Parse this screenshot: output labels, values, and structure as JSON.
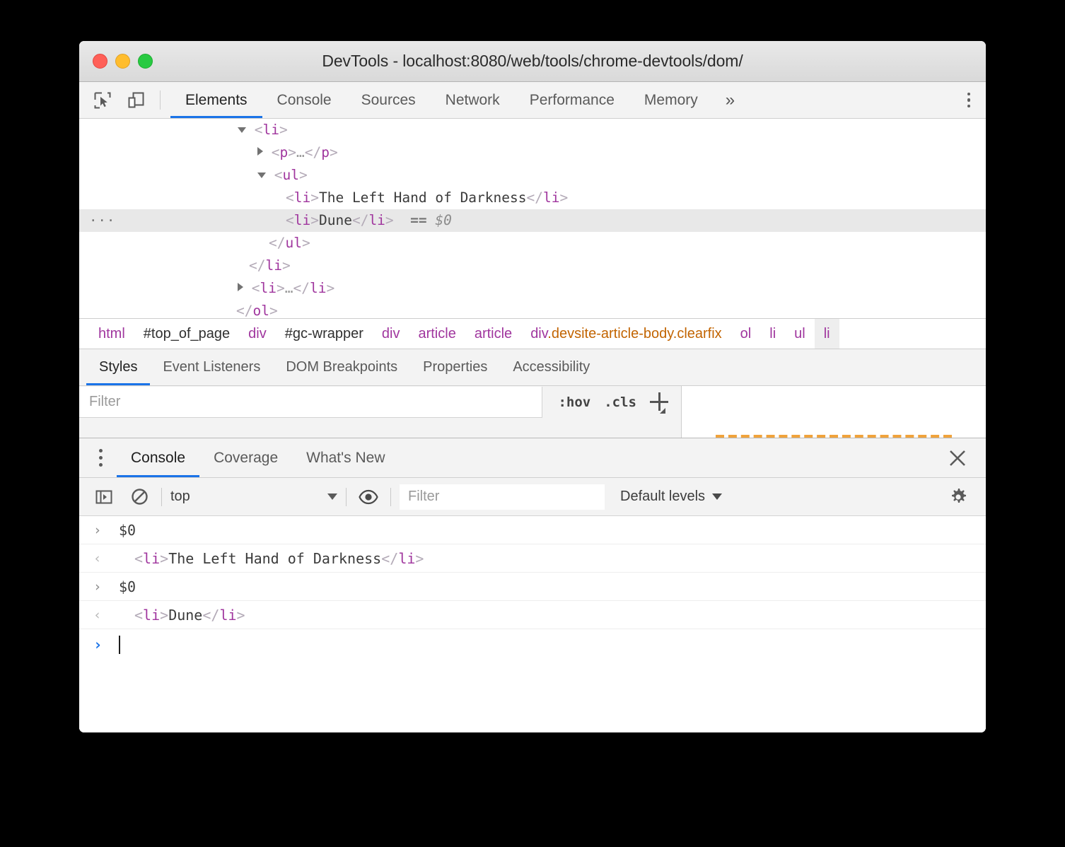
{
  "window": {
    "title": "DevTools - localhost:8080/web/tools/chrome-devtools/dom/",
    "traffic_lights": {
      "close": "close-button",
      "minimize": "minimize-button",
      "maximize": "maximize-button"
    },
    "colors": {
      "close": "#ff6058",
      "minimize": "#ffbd2e",
      "maximize": "#28ca42",
      "accent": "#1a73e8",
      "tag": "#a0369e",
      "class": "#c26401",
      "selected_row": "#e8e8e8",
      "box_model_margin": "#f0a33c"
    }
  },
  "toolbar": {
    "inspect_icon": "inspect-element-icon",
    "device_icon": "device-toolbar-icon",
    "more_tabs_label": "»",
    "main_menu_icon": "main-menu-icon",
    "tabs": [
      {
        "label": "Elements",
        "active": true
      },
      {
        "label": "Console",
        "active": false
      },
      {
        "label": "Sources",
        "active": false
      },
      {
        "label": "Network",
        "active": false
      },
      {
        "label": "Performance",
        "active": false
      },
      {
        "label": "Memory",
        "active": false
      }
    ]
  },
  "elements": {
    "dom_rows": [
      {
        "indent": 224,
        "twisty": "open",
        "selected": false,
        "parts": [
          {
            "c": "br",
            "t": "<"
          },
          {
            "c": "tag",
            "t": "li"
          },
          {
            "c": "br",
            "t": ">"
          }
        ]
      },
      {
        "indent": 252,
        "twisty": "closed",
        "selected": false,
        "parts": [
          {
            "c": "br",
            "t": "<"
          },
          {
            "c": "tag",
            "t": "p"
          },
          {
            "c": "br",
            "t": ">"
          },
          {
            "c": "ell",
            "t": "…"
          },
          {
            "c": "br",
            "t": "</"
          },
          {
            "c": "tag",
            "t": "p"
          },
          {
            "c": "br",
            "t": ">"
          }
        ]
      },
      {
        "indent": 252,
        "twisty": "open",
        "selected": false,
        "parts": [
          {
            "c": "br",
            "t": "<"
          },
          {
            "c": "tag",
            "t": "ul"
          },
          {
            "c": "br",
            "t": ">"
          }
        ]
      },
      {
        "indent": 292,
        "twisty": "none",
        "selected": false,
        "parts": [
          {
            "c": "br",
            "t": "<"
          },
          {
            "c": "tag",
            "t": "li"
          },
          {
            "c": "br",
            "t": ">"
          },
          {
            "c": "txt",
            "t": "The Left Hand of Darkness"
          },
          {
            "c": "br",
            "t": "</"
          },
          {
            "c": "tag",
            "t": "li"
          },
          {
            "c": "br",
            "t": ">"
          }
        ]
      },
      {
        "indent": 292,
        "twisty": "none",
        "selected": true,
        "gutter": "···",
        "parts": [
          {
            "c": "br",
            "t": "<"
          },
          {
            "c": "tag",
            "t": "li"
          },
          {
            "c": "br",
            "t": ">"
          },
          {
            "c": "txt",
            "t": "Dune"
          },
          {
            "c": "br",
            "t": "</"
          },
          {
            "c": "tag",
            "t": "li"
          },
          {
            "c": "br",
            "t": ">"
          },
          {
            "c": "eq",
            "t": "  =="
          },
          {
            "c": "dollar",
            "t": " $0"
          }
        ]
      },
      {
        "indent": 268,
        "twisty": "none",
        "selected": false,
        "parts": [
          {
            "c": "br",
            "t": "</"
          },
          {
            "c": "tag",
            "t": "ul"
          },
          {
            "c": "br",
            "t": ">"
          }
        ]
      },
      {
        "indent": 240,
        "twisty": "none",
        "selected": false,
        "parts": [
          {
            "c": "br",
            "t": "</"
          },
          {
            "c": "tag",
            "t": "li"
          },
          {
            "c": "br",
            "t": ">"
          }
        ]
      },
      {
        "indent": 224,
        "twisty": "closed",
        "selected": false,
        "parts": [
          {
            "c": "br",
            "t": "<"
          },
          {
            "c": "tag",
            "t": "li"
          },
          {
            "c": "br",
            "t": ">"
          },
          {
            "c": "ell",
            "t": "…"
          },
          {
            "c": "br",
            "t": "</"
          },
          {
            "c": "tag",
            "t": "li"
          },
          {
            "c": "br",
            "t": ">"
          }
        ]
      },
      {
        "indent": 222,
        "twisty": "none",
        "selected": false,
        "parts": [
          {
            "c": "br",
            "t": "</"
          },
          {
            "c": "tag",
            "t": "ol"
          },
          {
            "c": "br",
            "t": ">"
          }
        ]
      }
    ],
    "breadcrumb": [
      {
        "label": "html",
        "kind": "tag",
        "selected": false
      },
      {
        "label": "#top_of_page",
        "kind": "id",
        "selected": false
      },
      {
        "label": "div",
        "kind": "tag",
        "selected": false
      },
      {
        "label": "#gc-wrapper",
        "kind": "id",
        "selected": false
      },
      {
        "label": "div",
        "kind": "tag",
        "selected": false
      },
      {
        "label": "article",
        "kind": "tag",
        "selected": false
      },
      {
        "label": "article",
        "kind": "tag",
        "selected": false
      },
      {
        "label": "div",
        "cls": ".devsite-article-body.clearfix",
        "kind": "tag",
        "selected": false
      },
      {
        "label": "ol",
        "kind": "tag",
        "selected": false
      },
      {
        "label": "li",
        "kind": "tag",
        "selected": false
      },
      {
        "label": "ul",
        "kind": "tag",
        "selected": false
      },
      {
        "label": "li",
        "kind": "tag",
        "selected": true
      }
    ],
    "sidebar_tabs": [
      {
        "label": "Styles",
        "active": true
      },
      {
        "label": "Event Listeners",
        "active": false
      },
      {
        "label": "DOM Breakpoints",
        "active": false
      },
      {
        "label": "Properties",
        "active": false
      },
      {
        "label": "Accessibility",
        "active": false
      }
    ],
    "styles": {
      "filter_placeholder": "Filter",
      "hov_label": ":hov",
      "cls_label": ".cls",
      "new_rule_icon": "add-new-style-rule-icon"
    }
  },
  "drawer": {
    "menu_icon": "drawer-more-options-icon",
    "close_icon": "close-drawer-icon",
    "tabs": [
      {
        "label": "Console",
        "active": true
      },
      {
        "label": "Coverage",
        "active": false
      },
      {
        "label": "What's New",
        "active": false
      }
    ],
    "console_toolbar": {
      "sidebar_icon": "console-sidebar-icon",
      "clear_icon": "clear-console-icon",
      "context": "top",
      "eye_icon": "live-expression-icon",
      "filter_placeholder": "Filter",
      "levels": "Default levels",
      "settings_icon": "console-settings-icon"
    },
    "messages": [
      {
        "kind": "input",
        "arrow": "›",
        "parts": [
          {
            "c": "txt",
            "t": "$0"
          }
        ]
      },
      {
        "kind": "output",
        "arrow": "‹",
        "parts": [
          {
            "c": "br",
            "t": "<"
          },
          {
            "c": "tag",
            "t": "li"
          },
          {
            "c": "br",
            "t": ">"
          },
          {
            "c": "txt",
            "t": "The Left Hand of Darkness"
          },
          {
            "c": "br",
            "t": "</"
          },
          {
            "c": "tag",
            "t": "li"
          },
          {
            "c": "br",
            "t": ">"
          }
        ]
      },
      {
        "kind": "input",
        "arrow": "›",
        "parts": [
          {
            "c": "txt",
            "t": "$0"
          }
        ]
      },
      {
        "kind": "output",
        "arrow": "‹",
        "parts": [
          {
            "c": "br",
            "t": "<"
          },
          {
            "c": "tag",
            "t": "li"
          },
          {
            "c": "br",
            "t": ">"
          },
          {
            "c": "txt",
            "t": "Dune"
          },
          {
            "c": "br",
            "t": "</"
          },
          {
            "c": "tag",
            "t": "li"
          },
          {
            "c": "br",
            "t": ">"
          }
        ]
      }
    ],
    "prompt": {
      "arrow": "›",
      "value": ""
    }
  }
}
